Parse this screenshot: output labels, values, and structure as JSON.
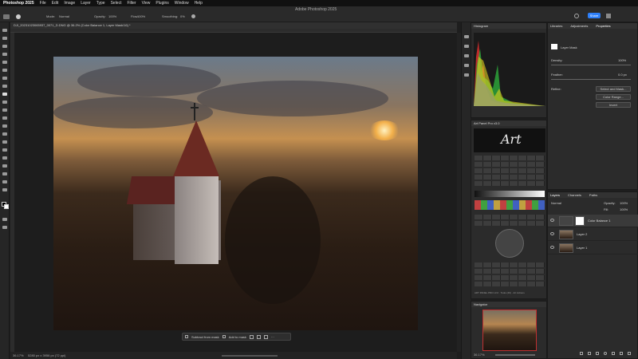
{
  "menubar": {
    "items": [
      "Photoshop 2025",
      "File",
      "Edit",
      "Image",
      "Layer",
      "Type",
      "Select",
      "Filter",
      "View",
      "Plugins",
      "Window",
      "Help"
    ]
  },
  "options": {
    "window_title": "Adobe Photoshop 2025",
    "mode_label": "Mode:",
    "mode_value": "Normal",
    "opacity_label": "Opacity:",
    "opacity_value": "100%",
    "flow_label": "Flow:",
    "flow_value": "100%",
    "smoothing_label": "Smoothing:",
    "smoothing_value": "0%",
    "share_label": "Share"
  },
  "document": {
    "tab_title": "DJI_20231023065937_0071_D.DNG @ 36.2% (Color Balance 1, Layer Mask/16) *"
  },
  "mask_bar": {
    "subtract_label": "Subtract from mask",
    "add_label": "Add to mask",
    "more_label": "···"
  },
  "status": {
    "zoom": "36.17%",
    "dimensions": "5280 px x 3956 px (72 ppi)"
  },
  "histogram": {
    "title": "Histogram"
  },
  "art_panel": {
    "title": "Art Panel Pro v3.0",
    "logo_text": "Art",
    "footer": "ART PANEL PRO v3.0 · Tools (49) · Art Actions"
  },
  "navigator": {
    "title": "Navigator",
    "zoom": "36.17%"
  },
  "properties": {
    "tabs": [
      "Libraries",
      "Adjustments",
      "Properties"
    ],
    "layer_mask_label": "Layer Mask",
    "density_label": "Density:",
    "density_value": "100%",
    "feather_label": "Feather:",
    "feather_value": "0.0 px",
    "refine_label": "Refine:",
    "select_mask_label": "Select and Mask...",
    "color_range_label": "Color Range...",
    "invert_label": "Invert"
  },
  "layers": {
    "tabs": [
      "Layers",
      "Channels",
      "Paths"
    ],
    "blend_mode": "Normal",
    "opacity_label": "Opacity:",
    "opacity_value": "100%",
    "fill_label": "Fill:",
    "fill_value": "100%",
    "rows": [
      {
        "name": "Color Balance 1"
      },
      {
        "name": "Layer 2"
      },
      {
        "name": "Layer 1"
      }
    ]
  },
  "colors": {
    "accent": "#2d7ff9"
  }
}
